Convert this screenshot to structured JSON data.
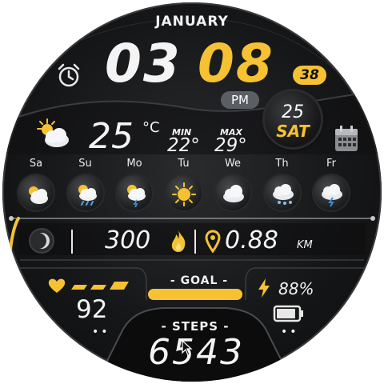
{
  "header": {
    "month": "JANUARY"
  },
  "time": {
    "hour": "03",
    "minute": "08",
    "seconds": "38",
    "ampm": "PM"
  },
  "date": {
    "day": "25",
    "weekday": "SAT"
  },
  "weather": {
    "current_temp": "25",
    "unit": "°C",
    "min_label": "MIN",
    "min_value": "22°",
    "max_label": "MAX",
    "max_value": "29°",
    "current_icon": "partly-cloudy-icon"
  },
  "forecast": [
    {
      "day": "Sa",
      "icon": "partly-cloudy-icon"
    },
    {
      "day": "Su",
      "icon": "sun-rain-icon"
    },
    {
      "day": "Mo",
      "icon": "sun-cloud-storm-icon"
    },
    {
      "day": "Tu",
      "icon": "sunny-icon"
    },
    {
      "day": "We",
      "icon": "cloudy-icon"
    },
    {
      "day": "Th",
      "icon": "cloud-snow-icon"
    },
    {
      "day": "Fr",
      "icon": "cloud-storm-icon"
    }
  ],
  "stats": {
    "calories": "300",
    "distance": "0.88",
    "distance_unit": "KM"
  },
  "goal": {
    "label": "- GOAL -",
    "progress": 1.0
  },
  "battery": {
    "percent": "88%",
    "level": 0.88
  },
  "heart": {
    "value": "92"
  },
  "steps": {
    "label": "- STEPS -",
    "value": "6543"
  },
  "colors": {
    "accent": "#f6c233",
    "face": "#161718",
    "text": "#f4f4f4"
  }
}
